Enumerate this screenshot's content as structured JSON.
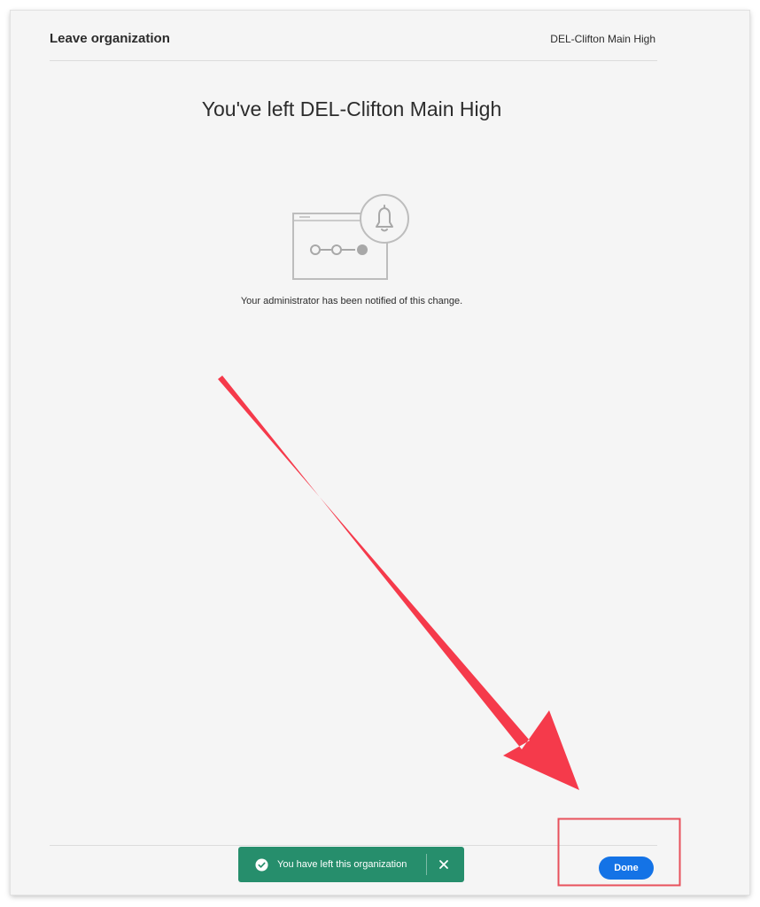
{
  "header": {
    "title": "Leave organization",
    "organization": "DEL-Clifton Main High"
  },
  "main": {
    "heading": "You've left DEL-Clifton Main High",
    "illustration_icon": "bell-notification-illustration",
    "notice": "Your administrator has been notified of this change."
  },
  "toast": {
    "message": "You have left this organization",
    "status_icon": "checkmark-circle-icon",
    "close_icon": "close-icon",
    "background_color": "#268e6c"
  },
  "footer": {
    "done_label": "Done",
    "accent_color": "#1473e6"
  },
  "annotation": {
    "arrow_color": "#f53a4b",
    "highlight_box_color": "#e8515c"
  }
}
